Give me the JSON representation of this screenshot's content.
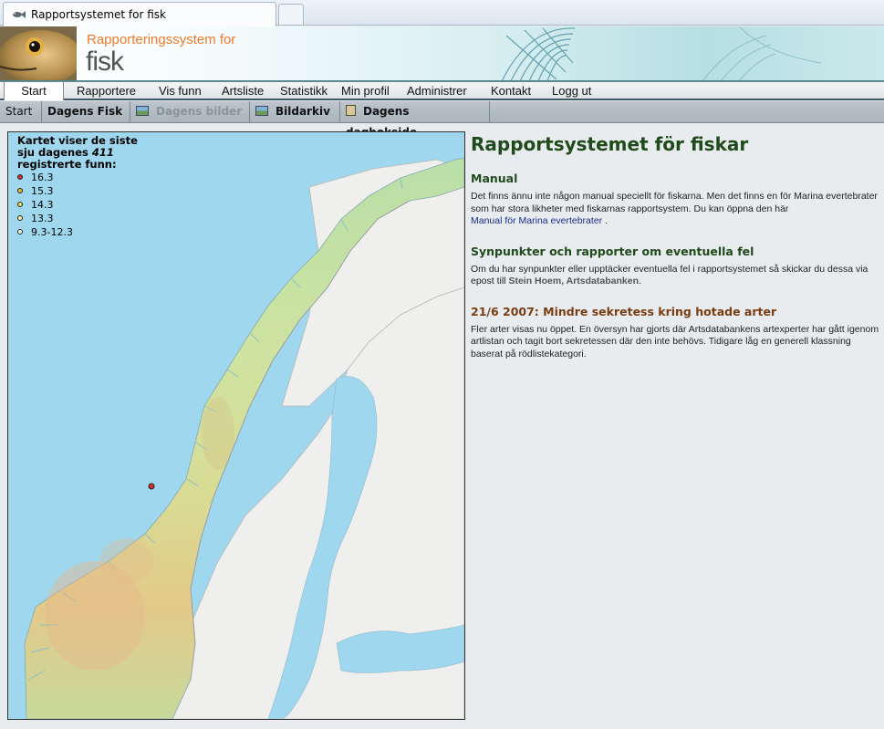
{
  "browser": {
    "tab_title": "Rapportsystemet for fisk"
  },
  "header": {
    "title": "Rapporteringssystem for",
    "subtitle": "fisk"
  },
  "mainnav": {
    "items": [
      {
        "label": "Start"
      },
      {
        "label": "Rapportere"
      },
      {
        "label": "Vis funn"
      },
      {
        "label": "Artsliste"
      },
      {
        "label": "Statistikk"
      },
      {
        "label": "Min profil"
      },
      {
        "label": "Administrer"
      },
      {
        "label": "Kontakt"
      },
      {
        "label": "Logg ut"
      }
    ]
  },
  "subnav": {
    "items": [
      {
        "label": "Start"
      },
      {
        "label": "Dagens Fisk"
      },
      {
        "label": "Dagens bilder"
      },
      {
        "label": "Bildarkiv"
      },
      {
        "label": "Dagens dagbokside"
      }
    ]
  },
  "map": {
    "legend_line1": "Kartet viser de siste",
    "legend_line2_prefix": "sju dagenes ",
    "legend_count": "411",
    "legend_line3": "registrerte funn:",
    "legend_items": [
      {
        "label": "16.3",
        "color": "#d4302a"
      },
      {
        "label": "15.3",
        "color": "#e8b62a"
      },
      {
        "label": "14.3",
        "color": "#ece05a"
      },
      {
        "label": "13.3",
        "color": "#f4f0a8"
      },
      {
        "label": "9.3-12.3",
        "color": "#fbfae0"
      }
    ]
  },
  "content": {
    "title": "Rapportsystemet för fiskar",
    "manual_heading": "Manual",
    "manual_text": "Det finns ännu inte någon manual speciellt för fiskarna. Men det finns en för Marina evertebrater som har stora likheter med fiskarnas rapportsystem. Du kan öppna den här",
    "manual_link": "Manual för Marina evertebrater",
    "manual_text_end": " .",
    "feedback_heading": "Synpunkter och rapporter om eventuella fel",
    "feedback_text": "Om du har synpunkter eller upptäcker eventuella fel i rapportsystemet så skickar du dessa via epost till ",
    "feedback_contact": "Stein Hoem, Artsdatabanken",
    "feedback_text_end": ".",
    "news_heading": "21/6 2007: Mindre sekretess kring hotade arter",
    "news_text": "Fler arter visas nu öppet. En översyn har gjorts där Artsdatabankens artexperter har gått igenom artlistan och tagit bort sekretessen där den inte behövs. Tidigare låg en generell klassning baserat på rödlistekategori."
  },
  "colors": {
    "heading_green": "#1f4a1a",
    "news_brown": "#7a3d12",
    "link_blue": "#1a2a8a",
    "brand_orange": "#f07a2a"
  }
}
